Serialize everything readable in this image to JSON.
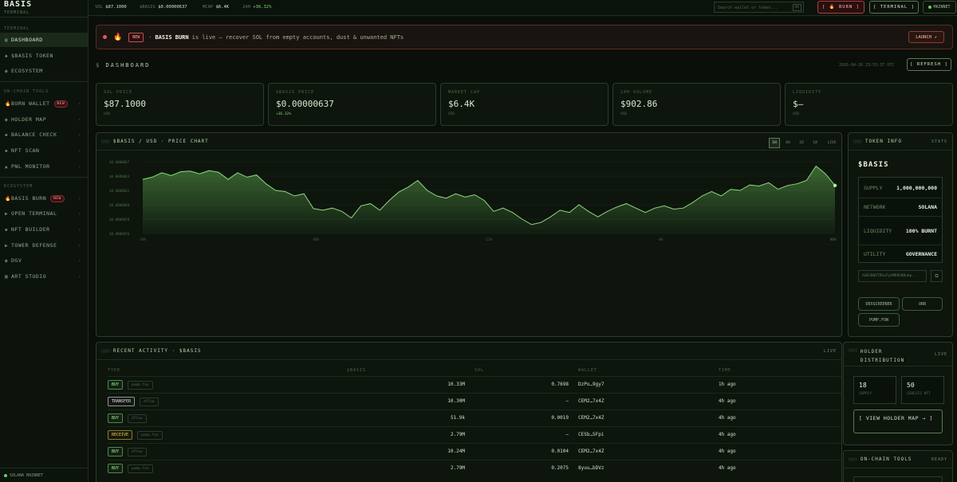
{
  "brand": {
    "name": "BASIS",
    "sub": "TERMINAL"
  },
  "sidebar": {
    "section_terminal": "TERMINAL",
    "terminal_items": [
      {
        "label": "DASHBOARD",
        "icon": "▣"
      },
      {
        "label": "$BASIS TOKEN",
        "icon": "◆"
      },
      {
        "label": "ECOSYSTEM",
        "icon": "◉"
      }
    ],
    "section_tools": "ON-CHAIN TOOLS",
    "tool_items": [
      {
        "label": "BURN WALLET",
        "icon": "🔥",
        "badge": "NEW"
      },
      {
        "label": "HOLDER MAP",
        "icon": "◉"
      },
      {
        "label": "BALANCE CHECK",
        "icon": "◆"
      },
      {
        "label": "NFT SCAN",
        "icon": "◆"
      },
      {
        "label": "PNL MONITOR",
        "icon": "▲"
      }
    ],
    "section_eco": "ECOSYSTEM",
    "eco_items": [
      {
        "label": "BASIS BURN",
        "icon": "🔥",
        "badge": "NEW"
      },
      {
        "label": "OPEN TERMINAL",
        "icon": "▶"
      },
      {
        "label": "NFT BUILDER",
        "icon": "◆"
      },
      {
        "label": "TOWER DEFENSE",
        "icon": "▶"
      },
      {
        "label": "DGV",
        "icon": "◉"
      },
      {
        "label": "ART STUDIO",
        "icon": "▦"
      }
    ],
    "footer": "SOLANA MAINNET"
  },
  "ticker": {
    "sol_label": "SOL",
    "sol": "$87.1000",
    "basis_label": "$BASIS",
    "basis": "$0.00000637",
    "mcap_label": "MCAP",
    "mcap": "$6.4K",
    "change_label": "24H",
    "change": "+36.32%"
  },
  "topbar": {
    "search_placeholder": "Search wallet or token...",
    "search_kbd": "⌘K",
    "burn": "[ 🔥 BURN ]",
    "terminal": "[ TERMINAL ]",
    "network": "MAINNET"
  },
  "banner": {
    "new": "NEW",
    "title": "BASIS BURN",
    "text": "is live — recover SOL from empty accounts, dust & unwanted NFTs",
    "launch": "LAUNCH ↗"
  },
  "dashboard": {
    "title": "DASHBOARD",
    "timestamp": "2026-04-26 23:55:37 UTC",
    "refresh": "[ REFRESH ]"
  },
  "stats": [
    {
      "label": "SOL PRICE",
      "value": "$87.1000",
      "sub": "USD"
    },
    {
      "label": "$BASIS PRICE",
      "value": "$0.00000637",
      "sub": "+36.32%"
    },
    {
      "label": "MARKET CAP",
      "value": "$6.4K",
      "sub": "USD"
    },
    {
      "label": "24H VOLUME",
      "value": "$902.86",
      "sub": "USD"
    },
    {
      "label": "LIQUIDITY",
      "value": "$—",
      "sub": "USD"
    }
  ],
  "chart_panel": {
    "title": "$BASIS / USD · PRICE CHART",
    "timeframes": [
      "1H",
      "6H",
      "1D",
      "1W"
    ],
    "live": "LIVE"
  },
  "chart_data": {
    "type": "area",
    "title": "$BASIS / USD · PRICE CHART",
    "yticks": [
      "$0.0000067",
      "$0.0000063",
      "$0.0000062",
      "$0.0000060",
      "$0.0000058",
      "$0.0000056"
    ],
    "xticks": [
      "-24h",
      "-18h",
      "-12h",
      "-6h",
      "NOW"
    ],
    "values": [
      6.48e-06,
      6.52e-06,
      6.6e-06,
      6.55e-06,
      6.62e-06,
      6.63e-06,
      6.58e-06,
      6.64e-06,
      6.61e-06,
      6.48e-06,
      6.6e-06,
      6.52e-06,
      6.56e-06,
      6.4e-06,
      6.28e-06,
      6.26e-06,
      6.18e-06,
      6.22e-06,
      5.95e-06,
      5.92e-06,
      5.96e-06,
      5.9e-06,
      5.78e-06,
      6e-06,
      6.04e-06,
      5.92e-06,
      6.1e-06,
      6.25e-06,
      6.34e-06,
      6.46e-06,
      6.28e-06,
      6.18e-06,
      6.14e-06,
      6.22e-06,
      6.16e-06,
      6.2e-06,
      6.1e-06,
      5.9e-06,
      5.96e-06,
      5.88e-06,
      5.76e-06,
      5.66e-06,
      5.7e-06,
      5.8e-06,
      5.92e-06,
      5.88e-06,
      6.02e-06,
      5.9e-06,
      5.8e-06,
      5.9e-06,
      5.98e-06,
      6.04e-06,
      5.96e-06,
      5.88e-06,
      5.96e-06,
      6e-06,
      5.94e-06,
      5.96e-06,
      6.06e-06,
      6.18e-06,
      6.26e-06,
      6.18e-06,
      6.3e-06,
      6.28e-06,
      6.38e-06,
      6.36e-06,
      6.42e-06,
      6.3e-06,
      6.37e-06,
      6.4e-06,
      6.46e-06,
      6.72e-06,
      6.58e-06,
      6.37e-06
    ],
    "ylim": [
      5.5e-06,
      6.8e-06
    ]
  },
  "token_info": {
    "title": "TOKEN INFO",
    "right": "STATS",
    "name": "$BASIS",
    "rows": [
      {
        "k": "SUPPLY",
        "v": "1,000,000,000"
      },
      {
        "k": "NETWORK",
        "v": "SOLANA"
      },
      {
        "k": "LIQUIDITY",
        "v": "100% BURNT"
      },
      {
        "k": "UTILITY",
        "v": "GOVERNANCE"
      }
    ],
    "address": "AGBJBQUTRSaTykMR9hRDuAp...",
    "copy": "⧉",
    "links": [
      "DEXSCREENER",
      "ORB",
      "PUMP.FUN"
    ]
  },
  "activity": {
    "title": "RECENT ACTIVITY · $BASIS",
    "live": "LIVE",
    "headers": [
      "TYPE",
      "$BASIS",
      "SOL",
      "WALLET",
      "TIME"
    ],
    "rows": [
      {
        "type": "BUY",
        "src": "pump.fun",
        "basis": "10.33M",
        "sol": "0.7698",
        "wallet": "DzPo…9gy7",
        "time": "1h ago"
      },
      {
        "type": "TRANSFER",
        "src": "dflow",
        "basis": "10.30M",
        "sol": "—",
        "wallet": "CEM2…7x4Z",
        "time": "4h ago"
      },
      {
        "type": "BUY",
        "src": "dflow",
        "basis": "51.9k",
        "sol": "0.0019",
        "wallet": "CEM2…7x4Z",
        "time": "4h ago"
      },
      {
        "type": "RECEIVE",
        "src": "pump.fun",
        "basis": "2.79M",
        "sol": "—",
        "wallet": "CESb…5Fpi",
        "time": "4h ago"
      },
      {
        "type": "BUY",
        "src": "dflow",
        "basis": "10.24M",
        "sol": "0.0104",
        "wallet": "CEM2…7x4Z",
        "time": "4h ago"
      },
      {
        "type": "BUY",
        "src": "pump.fun",
        "basis": "2.79M",
        "sol": "0.2075",
        "wallet": "8yuu…bDVz",
        "time": "4h ago"
      }
    ]
  },
  "holders": {
    "title": "HOLDER DISTRIBUTION",
    "live": "LIVE",
    "supply_n": "18",
    "supply_l": "SUPPLY",
    "nft_n": "50",
    "nft_l": "GENESIS NFT",
    "view": "[ VIEW HOLDER MAP → ]"
  },
  "tools_panel": {
    "title": "ON-CHAIN TOOLS",
    "right": "READY"
  },
  "colors": {
    "accent": "#7fd870",
    "bg": "#0a0f0a",
    "burn": "#b04040"
  }
}
